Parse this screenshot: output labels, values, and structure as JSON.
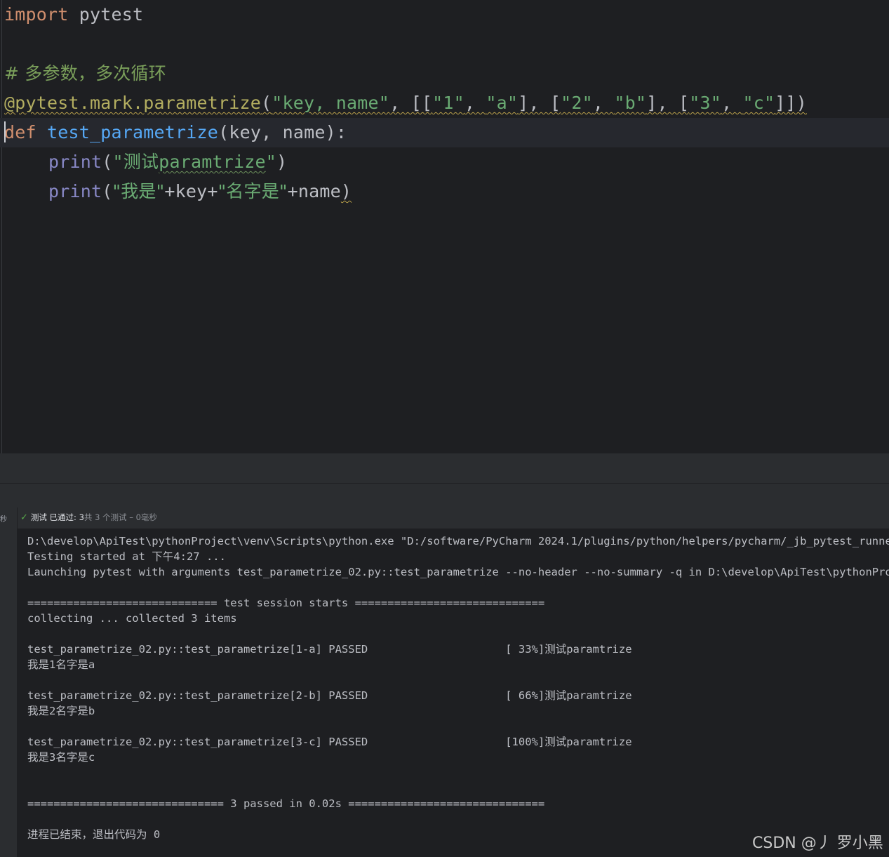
{
  "editor": {
    "line1": {
      "kw": "import",
      "rest": " pytest"
    },
    "line3": {
      "text": "# 多参数，多次循环"
    },
    "line4": {
      "decorator": "@pytest.mark.parametrize",
      "open": "(",
      "s1": "\"key, name\"",
      "sep1": ", [[",
      "s2": "\"1\"",
      "sep2": ", ",
      "s3": "\"a\"",
      "sep3": "], [",
      "s4": "\"2\"",
      "sep4": ", ",
      "s5": "\"b\"",
      "sep5": "], [",
      "s6": "\"3\"",
      "sep6": ", ",
      "s7": "\"c\"",
      "close": "]])"
    },
    "line5": {
      "kw": "def",
      "fn": "test_parametrize",
      "params": "(key, name):"
    },
    "line6": {
      "builtin": "print",
      "open": "(",
      "q1": "\"",
      "cjk": "测试",
      "typo": "paramtrize",
      "q2": "\"",
      "close": ")"
    },
    "line7": {
      "builtin": "print",
      "open": "(",
      "s1": "\"我是\"",
      "p1": "+key+",
      "s2": "\"名字是\"",
      "p2": "+name",
      "close": ")"
    }
  },
  "run_panel": {
    "left_strip_label": "秒",
    "status": {
      "label": "测试 已通过: 3",
      "detail": "共 3 个测试 – 0毫秒"
    },
    "console": [
      "D:\\develop\\ApiTest\\pythonProject\\venv\\Scripts\\python.exe \"D:/software/PyCharm 2024.1/plugins/python/helpers/pycharm/_jb_pytest_runner.py\"",
      "Testing started at 下午4:27 ...",
      "Launching pytest with arguments test_parametrize_02.py::test_parametrize --no-header --no-summary -q in D:\\develop\\ApiTest\\pythonProject",
      "",
      "============================= test session starts =============================",
      "collecting ... collected 3 items",
      "",
      "test_parametrize_02.py::test_parametrize[1-a] PASSED                     [ 33%]测试paramtrize",
      "我是1名字是a",
      "",
      "test_parametrize_02.py::test_parametrize[2-b] PASSED                     [ 66%]测试paramtrize",
      "我是2名字是b",
      "",
      "test_parametrize_02.py::test_parametrize[3-c] PASSED                     [100%]测试paramtrize",
      "我是3名字是c",
      "",
      "",
      "============================== 3 passed in 0.02s ==============================",
      "",
      "进程已结束，退出代码为 0"
    ]
  },
  "watermark": "CSDN @丿 罗小黑",
  "colors": {
    "background": "#1e1f22",
    "keyword": "#cf8e6d",
    "string": "#6aab73",
    "function": "#56a8f5",
    "decorator": "#b3ae60",
    "comment": "#7a9f5a",
    "builtin": "#8888c6",
    "pass": "#57a64a"
  }
}
